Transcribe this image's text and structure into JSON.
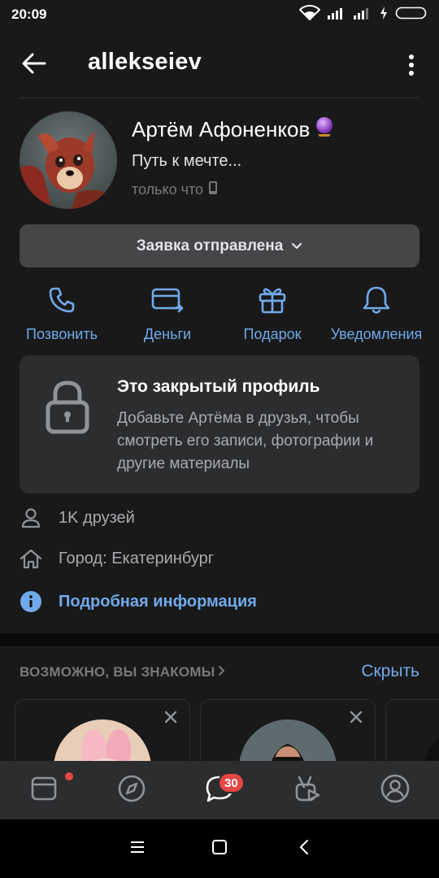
{
  "status_bar": {
    "time": "20:09"
  },
  "header": {
    "title": "allekseiev"
  },
  "profile": {
    "name": "Артём Афоненков",
    "status": "Путь к мечте...",
    "online": "только что"
  },
  "request_button": {
    "label": "Заявка отправлена"
  },
  "actions": [
    {
      "label": "Позвонить",
      "icon": "phone-icon"
    },
    {
      "label": "Деньги",
      "icon": "money-card-icon"
    },
    {
      "label": "Подарок",
      "icon": "gift-icon"
    },
    {
      "label": "Уведомления",
      "icon": "bell-icon"
    }
  ],
  "closed_profile": {
    "title": "Это закрытый профиль",
    "text": "Добавьте Артёма в друзья, чтобы смотреть его записи, фотографии и другие материалы"
  },
  "info": {
    "friends": "1K друзей",
    "city": "Город: Екатеринбург",
    "details": "Подробная информация"
  },
  "suggestions": {
    "header": "ВОЗМОЖНО, ВЫ ЗНАКОМЫ",
    "hide": "Скрыть"
  },
  "tab_bar": {
    "messages_badge": "30"
  },
  "colors": {
    "accent": "#71aaeb",
    "background": "#19191a",
    "card": "#2c2d2e",
    "badge": "#e64646"
  }
}
